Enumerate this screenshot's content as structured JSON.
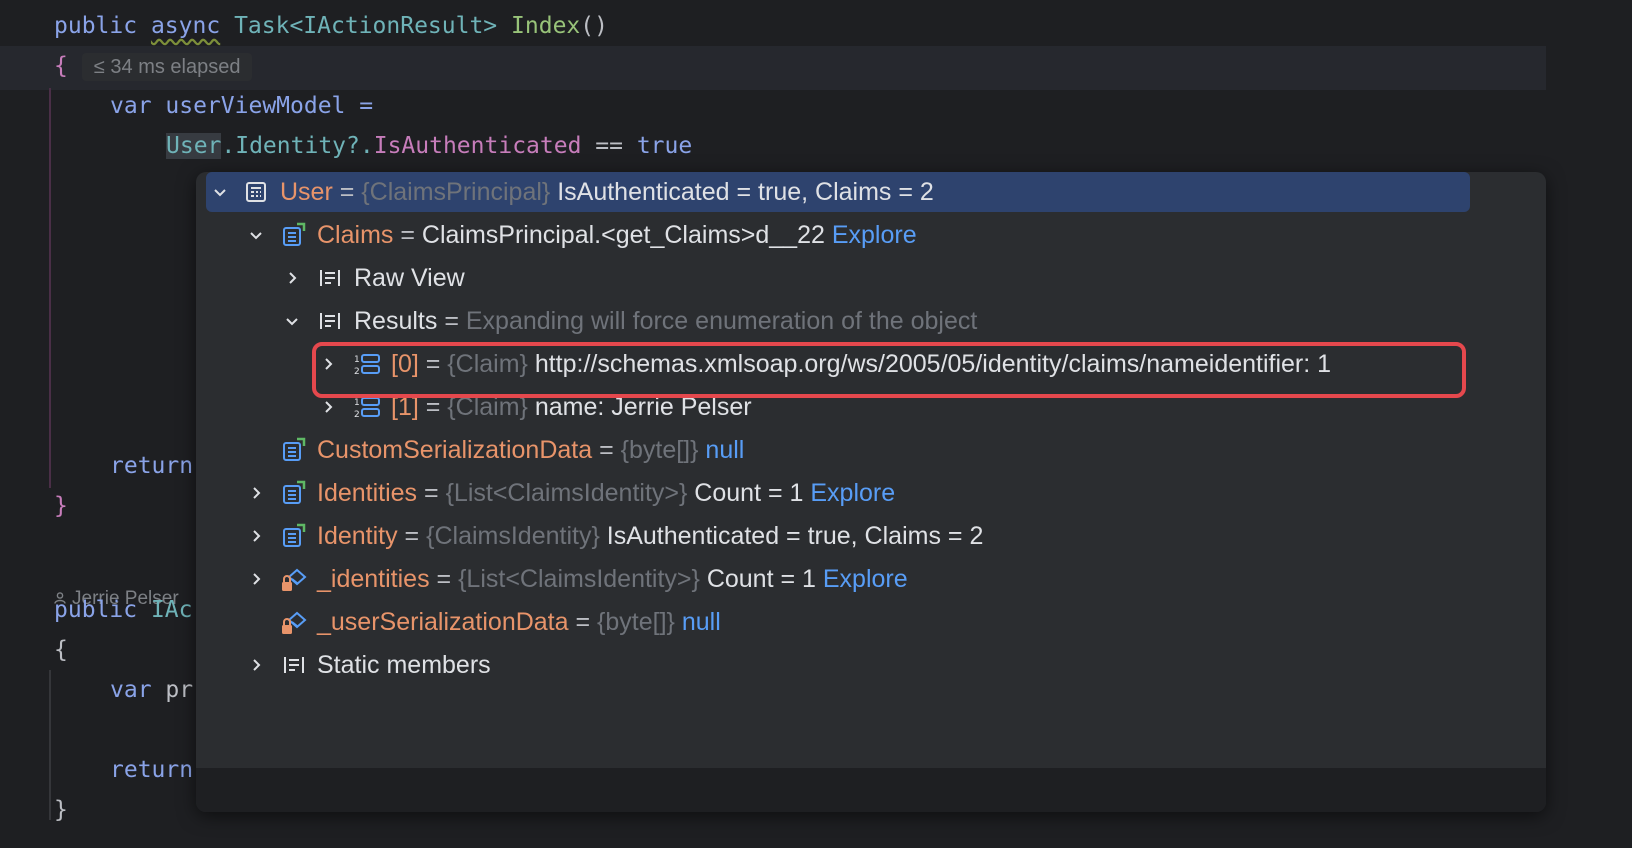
{
  "editor": {
    "method_signature": {
      "public": "public",
      "async": "async",
      "task": "Task<IActionResult>",
      "name": "Index",
      "parens": "()"
    },
    "open_brace": "{",
    "elapsed_hint": "≤ 34 ms elapsed",
    "line_var": "var userViewModel =",
    "line_user": "User",
    "line_identity": ".Identity?.",
    "line_isauth": "IsAuthenticated",
    "line_eq": " == ",
    "line_true": "true",
    "return1": "return",
    "close_brace1": "}",
    "author": "Jerrie Pelser",
    "sig2_public": "public",
    "sig2_type": "IAc",
    "open_brace2": "{",
    "var2": "var",
    "var2_name": "pr",
    "return2": "return",
    "close_brace2": "}"
  },
  "debugger": {
    "rows": [
      {
        "name": "User",
        "eq": " = ",
        "type": "{ClaimsPrincipal}",
        "value": " IsAuthenticated = true, Claims = 2",
        "expanded": true,
        "selected": true,
        "icon": "object-icon"
      },
      {
        "name": "Claims",
        "eq": " = ",
        "value": "ClaimsPrincipal.<get_Claims>d__22 ",
        "link": "Explore",
        "expanded": true,
        "icon": "property-icon"
      },
      {
        "name": "Raw View",
        "expanded": false,
        "icon": "raw-view-icon"
      },
      {
        "name": "Results",
        "eq": " = ",
        "gray": "Expanding will force enumeration of the object",
        "expanded": true,
        "icon": "raw-view-icon"
      },
      {
        "name": "[0]",
        "eq": " = ",
        "type": "{Claim}",
        "value": " http://schemas.xmlsoap.org/ws/2005/05/identity/claims/nameidentifier: 1",
        "expanded": false,
        "icon": "array-item-icon"
      },
      {
        "name": "[1]",
        "eq": " = ",
        "type": "{Claim}",
        "value": " name: Jerrie Pelser",
        "expanded": false,
        "icon": "array-item-icon"
      },
      {
        "name": "CustomSerializationData",
        "eq": " = ",
        "type": "{byte[]}",
        "kw": " null",
        "icon": "property-icon"
      },
      {
        "name": "Identities",
        "eq": " = ",
        "type": "{List<ClaimsIdentity>}",
        "value": " Count = 1 ",
        "link": "Explore",
        "expanded": false,
        "icon": "property-icon"
      },
      {
        "name": "Identity",
        "eq": " = ",
        "type": "{ClaimsIdentity}",
        "value": " IsAuthenticated = true, Claims = 2",
        "expanded": false,
        "icon": "property-icon"
      },
      {
        "name": "_identities",
        "eq": " = ",
        "type": "{List<ClaimsIdentity>}",
        "value": " Count = 1 ",
        "link": "Explore",
        "expanded": false,
        "icon": "private-field-icon"
      },
      {
        "name": "_userSerializationData",
        "eq": " = ",
        "type": "{byte[]}",
        "kw": " null",
        "icon": "private-field-icon"
      },
      {
        "name": "Static members",
        "expanded": false,
        "icon": "raw-view-icon"
      }
    ]
  },
  "colors": {
    "background": "#1e1f22",
    "popup": "#2b2d30",
    "selection": "#2e436e",
    "highlight_border": "#e5484d",
    "name_orange": "#e8946a",
    "link_blue": "#589df6"
  }
}
